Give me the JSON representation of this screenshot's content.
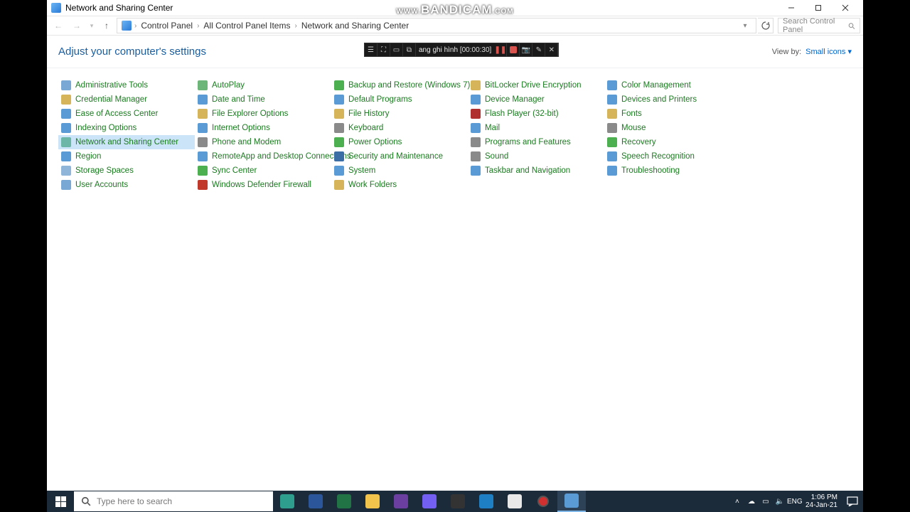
{
  "window": {
    "title": "Network and Sharing Center"
  },
  "watermark": {
    "prefix": "WWW.",
    "brand": "BANDICAM",
    "suffix": ".COM"
  },
  "breadcrumb": {
    "items": [
      "Control Panel",
      "All Control Panel Items",
      "Network and Sharing Center"
    ]
  },
  "search": {
    "placeholder": "Search Control Panel"
  },
  "header": {
    "title": "Adjust your computer's settings",
    "viewby_label": "View by:",
    "viewby_value": "Small icons"
  },
  "recorder": {
    "label": "ang ghi hình",
    "time": "[00:00:30]"
  },
  "items": {
    "c1": [
      {
        "name": "Administrative Tools",
        "ic": "#7aa8d4"
      },
      {
        "name": "Credential Manager",
        "ic": "#d6b55a"
      },
      {
        "name": "Ease of Access Center",
        "ic": "#5b9bd5"
      },
      {
        "name": "Indexing Options",
        "ic": "#5b9bd5"
      },
      {
        "name": "Network and Sharing Center",
        "ic": "#6cb6a8",
        "sel": true
      },
      {
        "name": "Region",
        "ic": "#5b9bd5"
      },
      {
        "name": "Storage Spaces",
        "ic": "#8fb5d8"
      },
      {
        "name": "User Accounts",
        "ic": "#7aa8d4"
      }
    ],
    "c2": [
      {
        "name": "AutoPlay",
        "ic": "#6cb67a"
      },
      {
        "name": "Date and Time",
        "ic": "#5b9bd5"
      },
      {
        "name": "File Explorer Options",
        "ic": "#d6b55a"
      },
      {
        "name": "Internet Options",
        "ic": "#5b9bd5"
      },
      {
        "name": "Phone and Modem",
        "ic": "#8a8a8a"
      },
      {
        "name": "RemoteApp and Desktop Connections",
        "ic": "#5b9bd5"
      },
      {
        "name": "Sync Center",
        "ic": "#4caf50"
      },
      {
        "name": "Windows Defender Firewall",
        "ic": "#c0392b"
      }
    ],
    "c3": [
      {
        "name": "Backup and Restore (Windows 7)",
        "ic": "#4caf50"
      },
      {
        "name": "Default Programs",
        "ic": "#5b9bd5"
      },
      {
        "name": "File History",
        "ic": "#d6b55a"
      },
      {
        "name": "Keyboard",
        "ic": "#8a8a8a"
      },
      {
        "name": "Power Options",
        "ic": "#4caf50"
      },
      {
        "name": "Security and Maintenance",
        "ic": "#3a6ea5"
      },
      {
        "name": "System",
        "ic": "#5b9bd5"
      },
      {
        "name": "Work Folders",
        "ic": "#d6b55a"
      }
    ],
    "c4": [
      {
        "name": "BitLocker Drive Encryption",
        "ic": "#d6b55a"
      },
      {
        "name": "Device Manager",
        "ic": "#5b9bd5"
      },
      {
        "name": "Flash Player (32-bit)",
        "ic": "#b03030"
      },
      {
        "name": "Mail",
        "ic": "#5b9bd5"
      },
      {
        "name": "Programs and Features",
        "ic": "#8a8a8a"
      },
      {
        "name": "Sound",
        "ic": "#8a8a8a"
      },
      {
        "name": "Taskbar and Navigation",
        "ic": "#5b9bd5"
      }
    ],
    "c5": [
      {
        "name": "Color Management",
        "ic": "#5b9bd5"
      },
      {
        "name": "Devices and Printers",
        "ic": "#5b9bd5"
      },
      {
        "name": "Fonts",
        "ic": "#d6b55a"
      },
      {
        "name": "Mouse",
        "ic": "#8a8a8a"
      },
      {
        "name": "Recovery",
        "ic": "#4caf50"
      },
      {
        "name": "Speech Recognition",
        "ic": "#5b9bd5"
      },
      {
        "name": "Troubleshooting",
        "ic": "#5b9bd5"
      }
    ]
  },
  "taskbar": {
    "search_placeholder": "Type here to search",
    "apps": [
      {
        "name": "edge",
        "color": "#2e9e8f"
      },
      {
        "name": "word",
        "color": "#2b579a"
      },
      {
        "name": "excel",
        "color": "#217346"
      },
      {
        "name": "explorer",
        "color": "#f2c44b"
      },
      {
        "name": "media",
        "color": "#6b3fa0"
      },
      {
        "name": "viber",
        "color": "#7360f2"
      },
      {
        "name": "terminal",
        "color": "#333333"
      },
      {
        "name": "ie",
        "color": "#1e7fc5"
      },
      {
        "name": "chat",
        "color": "#e8e8e8"
      },
      {
        "name": "record",
        "color": "#d03030"
      },
      {
        "name": "controlpanel",
        "color": "#5b9bd5",
        "active": true
      }
    ],
    "lang": "ENG",
    "time": "1:06 PM",
    "date": "24-Jan-21"
  }
}
